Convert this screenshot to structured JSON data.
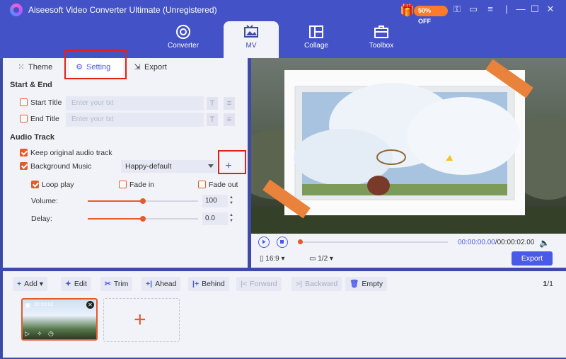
{
  "app": {
    "title": "Aiseesoft Video Converter Ultimate (Unregistered)",
    "promo_badge": "50% OFF"
  },
  "nav": {
    "tabs": [
      {
        "label": "Converter",
        "icon": "converter-icon"
      },
      {
        "label": "MV",
        "icon": "mv-icon",
        "active": true
      },
      {
        "label": "Collage",
        "icon": "collage-icon"
      },
      {
        "label": "Toolbox",
        "icon": "toolbox-icon"
      }
    ]
  },
  "subtabs": [
    {
      "label": "Theme",
      "icon": "theme-icon"
    },
    {
      "label": "Setting",
      "icon": "gear-icon",
      "active": true
    },
    {
      "label": "Export",
      "icon": "export-icon"
    }
  ],
  "start_end": {
    "title": "Start & End",
    "start_title_label": "Start Title",
    "end_title_label": "End Title",
    "placeholder": "Enter your txt"
  },
  "audio": {
    "title": "Audio Track",
    "keep_original_label": "Keep original audio track",
    "keep_original_checked": true,
    "bg_music_label": "Background Music",
    "bg_music_checked": true,
    "bg_music_value": "Happy-default",
    "loop_label": "Loop play",
    "loop_checked": true,
    "fade_in_label": "Fade in",
    "fade_out_label": "Fade out",
    "volume_label": "Volume:",
    "volume_value": "100",
    "volume_level": 0.5,
    "delay_label": "Delay:",
    "delay_value": "0.0",
    "delay_level": 0.5
  },
  "player": {
    "time_current": "00:00:00.00",
    "time_total": "/00:00:02.00",
    "aspect": "16:9",
    "page": "1/2",
    "export_label": "Export"
  },
  "toolbar": {
    "add": "Add",
    "edit": "Edit",
    "trim": "Trim",
    "ahead": "Ahead",
    "behind": "Behind",
    "forward": "Forward",
    "backward": "Backward",
    "empty": "Empty",
    "count_cur": "1",
    "count_total": "/1"
  },
  "clip": {
    "duration": "00:00:02"
  },
  "colors": {
    "brand": "#4352c6",
    "accent": "#e55a2b",
    "primary": "#4a5ae8",
    "highlight": "#e0211a"
  }
}
